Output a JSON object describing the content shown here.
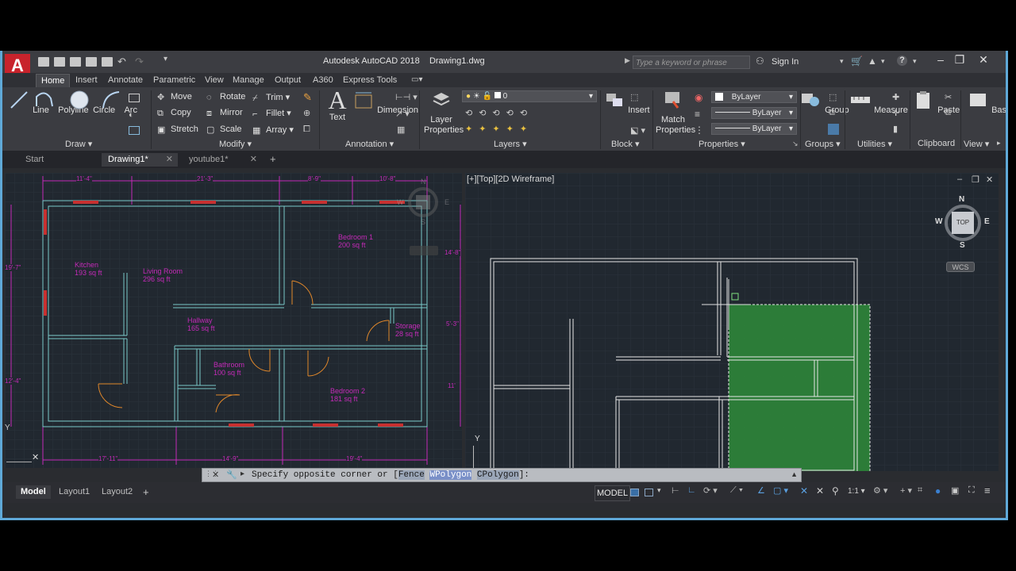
{
  "app": {
    "title": "Autodesk AutoCAD 2018",
    "document": "Drawing1.dwg",
    "search_placeholder": "Type a keyword or phrase",
    "sign_in": "Sign In",
    "logo_letter": "A"
  },
  "ribbon_tabs": [
    "Home",
    "Insert",
    "Annotate",
    "Parametric",
    "View",
    "Manage",
    "Output",
    "A360",
    "Express Tools"
  ],
  "draw": {
    "line": "Line",
    "polyline": "Polyline",
    "circle": "Circle",
    "arc": "Arc",
    "title": "Draw"
  },
  "modify": {
    "move": "Move",
    "rotate": "Rotate",
    "trim": "Trim",
    "copy": "Copy",
    "mirror": "Mirror",
    "fillet": "Fillet",
    "stretch": "Stretch",
    "scale": "Scale",
    "array": "Array",
    "title": "Modify"
  },
  "annotation": {
    "text": "Text",
    "dimension": "Dimension",
    "title": "Annotation"
  },
  "layers": {
    "layer_properties": "Layer Properties",
    "current_layer": "0",
    "title": "Layers"
  },
  "block": {
    "insert": "Insert",
    "title": "Block"
  },
  "properties": {
    "match": "Match Properties",
    "color": "ByLayer",
    "linetype": "ByLayer",
    "lineweight": "ByLayer",
    "title": "Properties"
  },
  "groups": {
    "group": "Group",
    "title": "Groups"
  },
  "utilities": {
    "measure": "Measure",
    "title": "Utilities"
  },
  "clipboard": {
    "paste": "Paste",
    "title": "Clipboard"
  },
  "view_panel": {
    "base": "Base",
    "title": "View"
  },
  "doc_tabs": [
    "Start",
    "Drawing1*",
    "youtube1*"
  ],
  "viewport": {
    "label": "[+][Top][2D Wireframe]",
    "compass": {
      "n": "N",
      "s": "S",
      "e": "E",
      "w": "W",
      "top": "TOP"
    },
    "wcs": "WCS"
  },
  "plan": {
    "rooms": [
      {
        "name": "Bedroom 1",
        "area": "200 sq ft"
      },
      {
        "name": "Kitchen",
        "area": "193 sq ft"
      },
      {
        "name": "Living Room",
        "area": "296 sq ft"
      },
      {
        "name": "Hallway",
        "area": "165 sq ft"
      },
      {
        "name": "Storage",
        "area": "28 sq ft"
      },
      {
        "name": "Bathroom",
        "area": "100 sq ft"
      },
      {
        "name": "Bedroom 2",
        "area": "181 sq ft"
      }
    ],
    "dims_top": [
      "11'-4\"",
      "21'-3\"",
      "8'-9\"",
      "10'-8\""
    ],
    "dims_bottom": [
      "17'-11\"",
      "14'-9\"",
      "19'-4\""
    ],
    "dims_left": [
      "19'-7\"",
      "12'-4\""
    ],
    "dims_right": [
      "14'-8\"",
      "5'-3\"",
      "11'"
    ],
    "compass": {
      "n": "N",
      "s": "S",
      "e": "E",
      "w": "W"
    }
  },
  "command": {
    "prompt": "Specify opposite corner or [",
    "opt1": "Fence",
    "opt2": "WPolygon",
    "opt3": "CPolygon",
    "end": "]:"
  },
  "layout_tabs": [
    "Model",
    "Layout1",
    "Layout2"
  ],
  "status": {
    "model": "MODEL",
    "scale": "1:1"
  },
  "colors": {
    "accent": "#5fa9d8",
    "wall_left": "#79c8c8",
    "dimension": "#c42ab8",
    "door": "#e0872a",
    "selection": "#2e8b3a"
  }
}
